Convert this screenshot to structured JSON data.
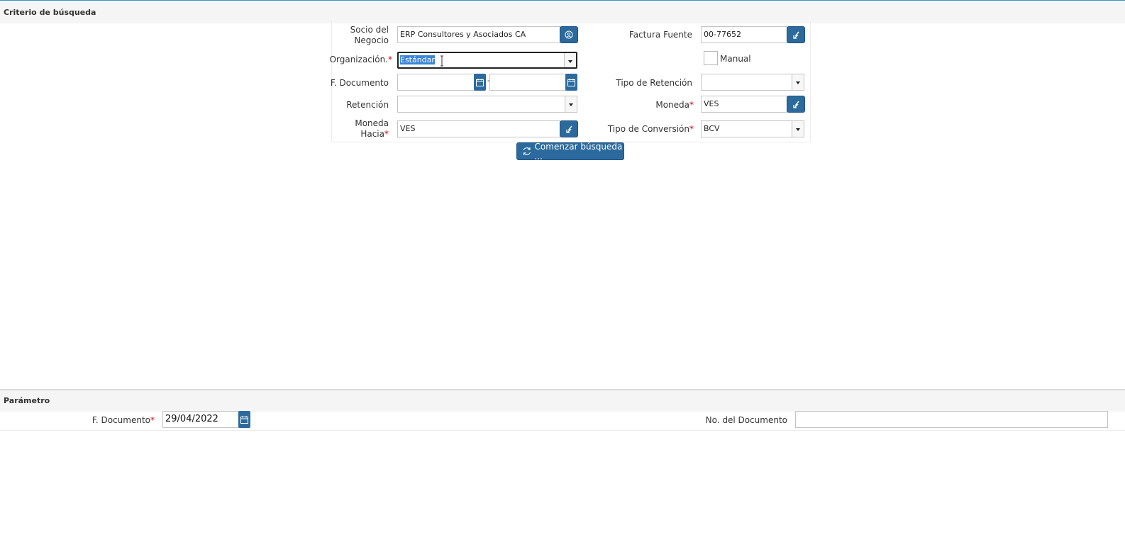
{
  "search": {
    "header": "Criterio de búsqueda",
    "bpartner": {
      "label_line1": "Socio del",
      "label_line2": "Negocio",
      "value": "ERP Consultores y Asociados CA",
      "icon": "bpartner-icon"
    },
    "org": {
      "label": "Organización.",
      "required": "*",
      "value": "Estándar"
    },
    "doc_date": {
      "label": "F. Documento",
      "from": "",
      "to": "",
      "dash": "-"
    },
    "retention": {
      "label": "Retención",
      "value": ""
    },
    "currency_to": {
      "label_line1": "Moneda",
      "label_line2": "Hacia",
      "required": "*",
      "value": "VES"
    },
    "source_invoice": {
      "label": "Factura Fuente",
      "value": "00-77652"
    },
    "manual": {
      "label": "Manual",
      "checked": false
    },
    "retention_type": {
      "label": "Tipo de Retención",
      "value": ""
    },
    "currency": {
      "label": "Moneda",
      "required": "*",
      "value": "VES"
    },
    "conversion_type": {
      "label": "Tipo de Conversión",
      "required": "*",
      "value": "BCV"
    },
    "start_button": "Comenzar búsqueda ..."
  },
  "params": {
    "header": "Parámetro",
    "doc_date": {
      "label": "F. Documento",
      "required": "*",
      "value": "29/04/2022"
    },
    "doc_no": {
      "label": "No. del Documento",
      "value": ""
    }
  },
  "colors": {
    "accent": "#2c6a9e",
    "required": "#d0021b",
    "selection": "#3b84d6"
  }
}
